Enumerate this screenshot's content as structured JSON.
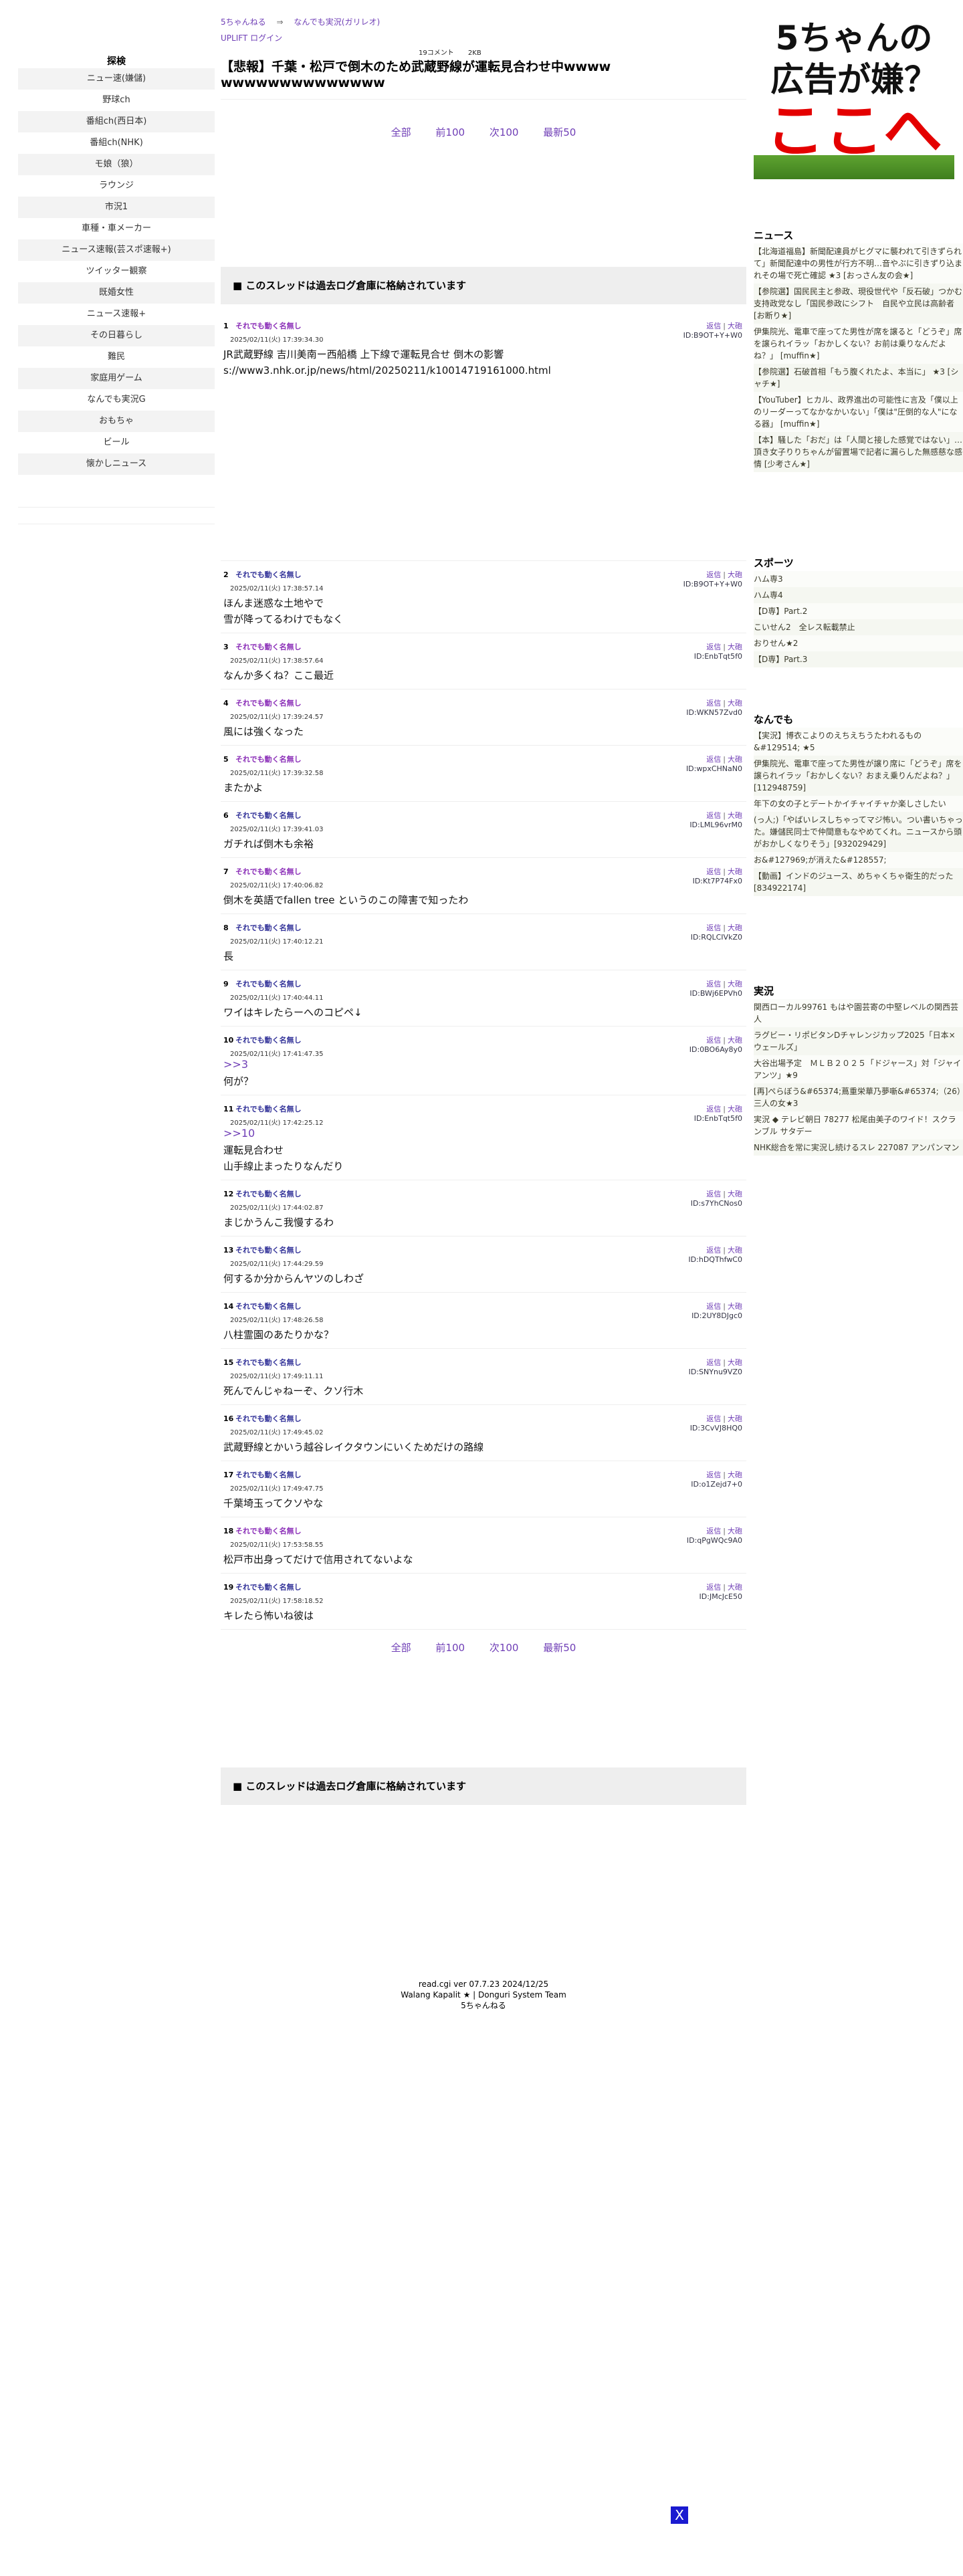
{
  "nav": {
    "board": "5ちゃんねる",
    "arrow": "⇒",
    "category": "なんでも実況(ガリレオ)",
    "uplift": "UPLIFT ログイン"
  },
  "meta": {
    "comments": "19コメント",
    "size": "2KB"
  },
  "thread_title": "【悲報】千葉・松戸で倒木のため武蔵野線が運転見合わせ中wwwwwwwwwwwwwwwwww",
  "pager": {
    "all": "全部",
    "prev": "前100",
    "next": "次100",
    "latest": "最新50"
  },
  "archived_notice": "■ このスレッドは過去ログ倉庫に格納されています",
  "left_menu": {
    "title": "探検",
    "items": [
      "ニュー速(嫌儲)",
      "野球ch",
      "番組ch(西日本)",
      "番組ch(NHK)",
      "モ娘（狼）",
      "ラウンジ",
      "市況1",
      "車種・車メーカー",
      "ニュース速報(芸スポ速報+)",
      "ツイッター観察",
      "既婚女性",
      "ニュース速報+",
      "その日暮らし",
      "難民",
      "家庭用ゲーム",
      "なんでも実況G",
      "おもちゃ",
      "ビール",
      "懐かしニュース"
    ]
  },
  "post_links": {
    "quote": "返信",
    "sep": "|",
    "big": "大砲"
  },
  "posts": [
    {
      "num": "1",
      "name": "それでも動く名無し",
      "color": "purple",
      "date": "2025/02/11(火) 17:39:34.30",
      "id": "ID:B9OT+Y+W0",
      "body": "JR武蔵野線 吉川美南ー西船橋 上下線で運転見合せ 倒木の影響\ns://www3.nhk.or.jp/news/html/20250211/k10014719161000.html"
    },
    {
      "num": "2",
      "name": "それでも動く名無し",
      "color": "blue",
      "date": "2025/02/11(火) 17:38:57.14",
      "id": "ID:B9OT+Y+W0",
      "body": "ほんま迷惑な土地やで\n雪が降ってるわけでもなく"
    },
    {
      "num": "3",
      "name": "それでも動く名無し",
      "color": "purple",
      "date": "2025/02/11(火) 17:38:57.64",
      "id": "ID:EnbTqt5f0",
      "body": "なんか多くね？ここ最近"
    },
    {
      "num": "4",
      "name": "それでも動く名無し",
      "color": "purple",
      "date": "2025/02/11(火) 17:39:24.57",
      "id": "ID:WKN57Zvd0",
      "body": "風には強くなった"
    },
    {
      "num": "5",
      "name": "それでも動く名無し",
      "color": "purple",
      "date": "2025/02/11(火) 17:39:32.58",
      "id": "ID:wpxCHNaN0",
      "body": "またかよ"
    },
    {
      "num": "6",
      "name": "それでも動く名無し",
      "color": "blue",
      "date": "2025/02/11(火) 17:39:41.03",
      "id": "ID:LML96vrM0",
      "body": "ガチれば倒木も余裕"
    },
    {
      "num": "7",
      "name": "それでも動く名無し",
      "color": "purple",
      "date": "2025/02/11(火) 17:40:06.82",
      "id": "ID:Kt7P74Fx0",
      "body": "倒木を英語でfallen tree というのこの障害で知ったわ"
    },
    {
      "num": "8",
      "name": "それでも動く名無し",
      "color": "blue",
      "date": "2025/02/11(火) 17:40:12.21",
      "id": "ID:RQLCIVkZ0",
      "body": "長"
    },
    {
      "num": "9",
      "name": "それでも動く名無し",
      "color": "blue",
      "date": "2025/02/11(火) 17:40:44.11",
      "id": "ID:BWj6EPVh0",
      "body": "ワイはキレたらーへのコピペ↓"
    },
    {
      "num": "10",
      "name": "それでも動く名無し",
      "color": "blue",
      "date": "2025/02/11(火) 17:41:47.35",
      "id": "ID:0BO6Ay8y0",
      "anchor": ">>3",
      "body": "何が？"
    },
    {
      "num": "11",
      "name": "それでも動く名無し",
      "color": "blue",
      "date": "2025/02/11(火) 17:42:25.12",
      "id": "ID:EnbTqt5f0",
      "anchor": ">>10",
      "body": "運転見合わせ\n山手線止まったりなんだり"
    },
    {
      "num": "12",
      "name": "それでも動く名無し",
      "color": "blue",
      "date": "2025/02/11(火) 17:44:02.87",
      "id": "ID:s7YhCNos0",
      "body": "まじかうんこ我慢するわ"
    },
    {
      "num": "13",
      "name": "それでも動く名無し",
      "color": "blue",
      "date": "2025/02/11(火) 17:44:29.59",
      "id": "ID:hDQThfwC0",
      "body": "何するか分からんヤツのしわざ"
    },
    {
      "num": "14",
      "name": "それでも動く名無し",
      "color": "blue",
      "date": "2025/02/11(火) 17:48:26.58",
      "id": "ID:2UY8DJgc0",
      "body": "八柱霊園のあたりかな？"
    },
    {
      "num": "15",
      "name": "それでも動く名無し",
      "color": "blue",
      "date": "2025/02/11(火) 17:49:11.11",
      "id": "ID:SNYnu9VZ0",
      "body": "死んでんじゃねーぞ、クソ行木"
    },
    {
      "num": "16",
      "name": "それでも動く名無し",
      "color": "blue",
      "date": "2025/02/11(火) 17:49:45.02",
      "id": "ID:3CvVJ8HQ0",
      "body": "武蔵野線とかいう越谷レイクタウンにいくためだけの路線"
    },
    {
      "num": "17",
      "name": "それでも動く名無し",
      "color": "blue",
      "date": "2025/02/11(火) 17:49:47.75",
      "id": "ID:o1Zejd7+0",
      "body": "千葉埼玉ってクソやな"
    },
    {
      "num": "18",
      "name": "それでも動く名無し",
      "color": "purple",
      "date": "2025/02/11(火) 17:53:58.55",
      "id": "ID:qPgWQc9A0",
      "body": "松戸市出身ってだけで信用されてないよな"
    },
    {
      "num": "19",
      "name": "それでも動く名無し",
      "color": "blue",
      "date": "2025/02/11(火) 17:58:18.52",
      "id": "ID:JMcJcE50",
      "body": "キレたら怖いね彼は"
    }
  ],
  "footer": {
    "line1": "read.cgi ver 07.7.23 2024/12/25",
    "line2": "Walang Kapalit ★ | Donguri System Team",
    "line3": "5ちゃんねる"
  },
  "ad": {
    "line1": "5ちゃんの",
    "line2": "広告が嫌？",
    "line3": "ここへ"
  },
  "sidebar": {
    "news": {
      "title": "ニュース",
      "items": [
        "【北海道福島】新聞配達員がヒグマに襲われて引きずられて」新聞配達中の男性が行方不明…音やぶに引きずり込まれその場で死亡確認 ★3 [おっさん友の会★]",
        "【参院選】国民民主と参政、現役世代や「反石破」つかむ　支持政党なし「国民参政にシフト　自民や立民は高齢者 [お断り★]",
        "伊集院光、電車で座ってた男性が席を譲ると「どうぞ」席を譲られイラッ「おかしくない？お前は乗りなんだよね？」 [muffin★]",
        "【参院選】石破首相「もう腹くれたよ、本当に」 ★3 [シャチ★]",
        "【YouTuber】ヒカル、政界進出の可能性に言及「僕以上のリーダーってなかなかいない」「僕は\"圧倒的な人\"になる器」 [muffin★]",
        "【本】騒した「おだ」は「人間と接した感覚ではない」…頂き女子りりちゃんが留置場で記者に漏らした無感慈な感情 [少考さん★]"
      ]
    },
    "sports": {
      "title": "スポーツ",
      "items": [
        "ハム専3",
        "ハム専4",
        "【D専】Part.2",
        "こいせん2　全レス転載禁止",
        "おりせん★2",
        "【D専】Part.3"
      ]
    },
    "nandemo": {
      "title": "なんでも",
      "items": [
        "【実況】博衣こよりのえちえちうたわれるもの&#129514; ★5",
        "伊集院光、電車で座ってた男性が譲り席に「どうぞ」席を譲られイラッ「おかしくない？おまえ乗りんだよね？」[112948759]",
        "年下の女の子とデートかイチャイチャか楽しさしたい",
        "(っ人;)「やばいレスしちゃってマジ怖い。つい書いちゃった。嫌儲民同士で仲間意もなやめてくれ。ニュースから頭がおかしくなりそう」[932029429]",
        "お&#127969;が消えた&#128557;",
        "【動画】インドのジュース、めちゃくちゃ衛生的だった [834922174]"
      ]
    },
    "jikkyo": {
      "title": "実況",
      "items": [
        "関西ローカル99761 もはや園芸寄の中堅レベルの関西芸人",
        "ラグビー・リポビタンDチャレンジカップ2025「日本×ウェールズ」",
        "大谷出場予定　ＭＬＢ２０２５「ドジャース」対「ジャイアンツ」★9",
        "[再]ぺらぼう&#65374;蔦重栄華乃夢噺&#65374;（26）三人の女★3",
        "実況 ◆ テレビ朝日 78277 松尾由美子のワイド！スクランブル サタデー",
        "NHK総合を常に実況し続けるスレ 227087 アンパンマン"
      ]
    }
  },
  "close_button": "X"
}
